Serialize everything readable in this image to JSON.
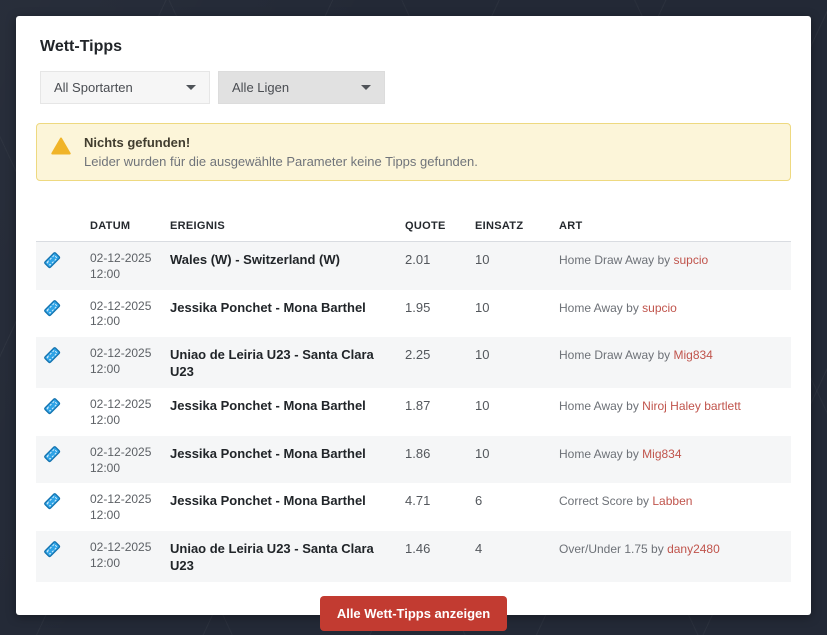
{
  "page": {
    "title": "Wett-Tipps"
  },
  "filters": {
    "sport": {
      "value": "All Sportarten"
    },
    "league": {
      "value": "Alle Ligen"
    }
  },
  "alert": {
    "title": "Nichts gefunden!",
    "message": "Leider wurden für die ausgewählte Parameter keine Tipps gefunden."
  },
  "table": {
    "headers": [
      "DATUM",
      "EREIGNIS",
      "QUOTE",
      "EINSATZ",
      "ART"
    ],
    "rows": [
      {
        "date": "02-12-2025",
        "time": "12:00",
        "event": "Wales (W) - Switzerland (W)",
        "quote": "2.01",
        "stake": "10",
        "bet_type": "Home Draw Away by",
        "tipster": "supcio"
      },
      {
        "date": "02-12-2025",
        "time": "12:00",
        "event": "Jessika Ponchet - Mona Barthel",
        "quote": "1.95",
        "stake": "10",
        "bet_type": "Home Away by",
        "tipster": "supcio"
      },
      {
        "date": "02-12-2025",
        "time": "12:00",
        "event": "Uniao de Leiria U23 - Santa Clara U23",
        "quote": "2.25",
        "stake": "10",
        "bet_type": "Home Draw Away by",
        "tipster": "Mig834"
      },
      {
        "date": "02-12-2025",
        "time": "12:00",
        "event": "Jessika Ponchet - Mona Barthel",
        "quote": "1.87",
        "stake": "10",
        "bet_type": "Home Away by",
        "tipster": "Niroj Haley bartlett"
      },
      {
        "date": "02-12-2025",
        "time": "12:00",
        "event": "Jessika Ponchet - Mona Barthel",
        "quote": "1.86",
        "stake": "10",
        "bet_type": "Home Away by",
        "tipster": "Mig834"
      },
      {
        "date": "02-12-2025",
        "time": "12:00",
        "event": "Jessika Ponchet - Mona Barthel",
        "quote": "4.71",
        "stake": "6",
        "bet_type": "Correct Score by",
        "tipster": "Labben"
      },
      {
        "date": "02-12-2025",
        "time": "12:00",
        "event": "Uniao de Leiria U23 - Santa Clara U23",
        "quote": "1.46",
        "stake": "4",
        "bet_type": "Over/Under 1.75 by",
        "tipster": "dany2480"
      }
    ]
  },
  "footer": {
    "button_label": "Alle Wett-Tipps anzeigen"
  },
  "icons": {
    "ticket": "ticket-icon",
    "warning": "warning-triangle-icon",
    "caret": "caret-down-icon"
  },
  "colors": {
    "background_dark": "#232936",
    "button_red": "#c23b31",
    "ticket_blue": "#2ea3e6",
    "warning_yellow": "#f0b429",
    "alert_bg": "#fcf5d9",
    "tipster_link": "#c0544c"
  }
}
